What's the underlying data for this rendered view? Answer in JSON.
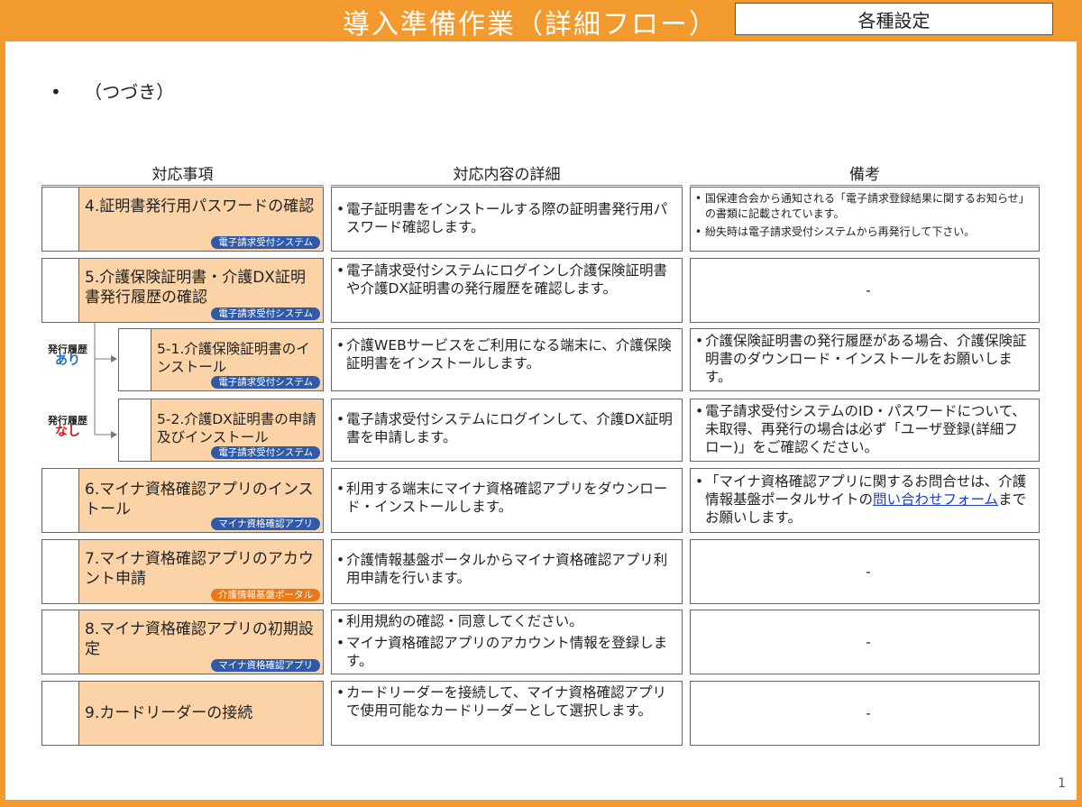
{
  "header": {
    "title": "導入準備作業（詳細フロー）",
    "category": "各種設定"
  },
  "intro": "（つづき）",
  "columns": {
    "task": "対応事項",
    "detail": "対応内容の詳細",
    "remarks": "備考"
  },
  "branches": {
    "yes": {
      "label": "発行履歴",
      "value": "あり"
    },
    "no": {
      "label": "発行履歴",
      "value": "なし"
    }
  },
  "rows": [
    {
      "task": "4.証明書発行用パスワードの確認",
      "tag": "電子請求受付システム",
      "details": [
        "電子証明書をインストールする際の証明書発行用パスワード確認します。"
      ],
      "remarks": [
        "国保連合会から通知される「電子請求登録結果に関するお知らせ」の書類に記載されています。",
        "紛失時は電子請求受付システムから再発行して下さい。"
      ]
    },
    {
      "task": "5.介護保険証明書・介護DX証明書発行履歴の確認",
      "tag": "電子請求受付システム",
      "details": [
        "電子請求受付システムにログインし介護保険証明書や介護DX証明書の発行履歴を確認します。"
      ],
      "remarks_text": "-"
    },
    {
      "task": "5-1.介護保険証明書のインストール",
      "tag": "電子請求受付システム",
      "details": [
        "介護WEBサービスをご利用になる端末に、介護保険証明書をインストールします。"
      ],
      "remarks": [
        "介護保険証明書の発行履歴がある場合、介護保険証明書のダウンロード・インストールをお願いします。"
      ]
    },
    {
      "task": "5-2.介護DX証明書の申請及びインストール",
      "tag": "電子請求受付システム",
      "details": [
        "電子請求受付システムにログインして、介護DX証明書を申請します。"
      ],
      "remarks": [
        "電子請求受付システムのID・パスワードについて、未取得、再発行の場合は必ず「ユーザ登録(詳細フロー)」をご確認ください。"
      ]
    },
    {
      "task": "6.マイナ資格確認アプリのインストール",
      "tag": "マイナ資格確認アプリ",
      "details": [
        "利用する端末にマイナ資格確認アプリをダウンロード・インストールします。"
      ],
      "remarks_pre": "「マイナ資格確認アプリに関するお問合せは、介護情報基盤ポータルサイトの",
      "remarks_link": "問い合わせフォーム",
      "remarks_post": "までお願いします。"
    },
    {
      "task": "7.マイナ資格確認アプリのアカウント申請",
      "tag": "介護情報基盤ポータル",
      "details": [
        "介護情報基盤ポータルからマイナ資格確認アプリ利用申請を行います。"
      ],
      "remarks_text": "-"
    },
    {
      "task": "8.マイナ資格確認アプリの初期設定",
      "tag": "マイナ資格確認アプリ",
      "details": [
        "利用規約の確認・同意してください。",
        "マイナ資格確認アプリのアカウント情報を登録します。"
      ],
      "remarks_text": "-"
    },
    {
      "task": "9.カードリーダーの接続",
      "details": [
        "カードリーダーを接続して、マイナ資格確認アプリで使用可能なカードリーダーとして選択します。"
      ],
      "remarks_text": "-"
    }
  ],
  "page_number": "1",
  "colors": {
    "accent": "#f39a2f",
    "task_fill": "#fbd3a7",
    "tag_blue": "#2e5aa8",
    "tag_orange": "#e8781a",
    "yes_blue": "#1f6fc5",
    "no_red": "#d4141c"
  }
}
